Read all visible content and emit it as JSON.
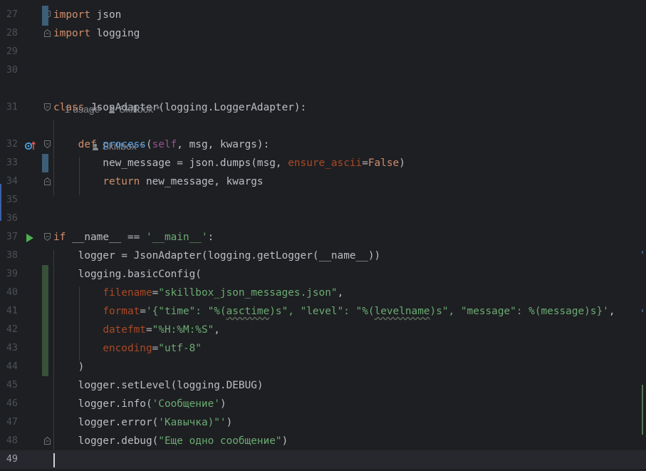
{
  "editor": {
    "lines": [
      {
        "num": "27",
        "tokens": [
          [
            "kw",
            "import"
          ],
          [
            "plain",
            " json"
          ]
        ]
      },
      {
        "num": "28",
        "tokens": [
          [
            "kw",
            "import"
          ],
          [
            "plain",
            " logging"
          ]
        ]
      },
      {
        "num": "29",
        "tokens": []
      },
      {
        "num": "30",
        "tokens": []
      },
      {
        "num": "31",
        "tokens": [
          [
            "kw",
            "class "
          ],
          [
            "plain",
            "JsonAdapter(logging.LoggerAdapter):"
          ]
        ]
      },
      {
        "num": "32",
        "tokens": [
          [
            "plain",
            "    "
          ],
          [
            "kw",
            "def "
          ],
          [
            "fn",
            "process"
          ],
          [
            "plain",
            "("
          ],
          [
            "self",
            "self"
          ],
          [
            "plain",
            ", msg, kwargs):"
          ]
        ]
      },
      {
        "num": "33",
        "tokens": [
          [
            "plain",
            "        new_message = json.dumps(msg, "
          ],
          [
            "param",
            "ensure_ascii"
          ],
          [
            "plain",
            "="
          ],
          [
            "kw",
            "False"
          ],
          [
            "plain",
            ")"
          ]
        ]
      },
      {
        "num": "34",
        "tokens": [
          [
            "plain",
            "        "
          ],
          [
            "kw",
            "return "
          ],
          [
            "plain",
            "new_message, kwargs"
          ]
        ]
      },
      {
        "num": "35",
        "tokens": []
      },
      {
        "num": "36",
        "tokens": []
      },
      {
        "num": "37",
        "tokens": [
          [
            "kw",
            "if "
          ],
          [
            "plain",
            "__name__ == "
          ],
          [
            "str",
            "'__main__'"
          ],
          [
            "plain",
            ":"
          ]
        ]
      },
      {
        "num": "38",
        "tokens": [
          [
            "plain",
            "    logger = JsonAdapter(logging.getLogger(__name__))"
          ]
        ]
      },
      {
        "num": "39",
        "tokens": [
          [
            "plain",
            "    logging.basicConfig("
          ]
        ]
      },
      {
        "num": "40",
        "tokens": [
          [
            "plain",
            "        "
          ],
          [
            "param",
            "filename"
          ],
          [
            "plain",
            "="
          ],
          [
            "str",
            "\"skillbox_json_messages.json\""
          ],
          [
            "plain",
            ","
          ]
        ]
      },
      {
        "num": "41",
        "tokens": [
          [
            "plain",
            "        "
          ],
          [
            "param",
            "format"
          ],
          [
            "plain",
            "="
          ],
          [
            "str",
            "'{\"time\": \"%("
          ],
          [
            "strw",
            "asctime"
          ],
          [
            "str",
            ")s\", \"level\": \"%("
          ],
          [
            "strw",
            "levelname"
          ],
          [
            "str",
            ")s\", \"message\": %(message)s}'"
          ],
          [
            "plain",
            ","
          ]
        ]
      },
      {
        "num": "42",
        "tokens": [
          [
            "plain",
            "        "
          ],
          [
            "param",
            "datefmt"
          ],
          [
            "plain",
            "="
          ],
          [
            "str",
            "\"%H:%M:%S\""
          ],
          [
            "plain",
            ","
          ]
        ]
      },
      {
        "num": "43",
        "tokens": [
          [
            "plain",
            "        "
          ],
          [
            "param",
            "encoding"
          ],
          [
            "plain",
            "="
          ],
          [
            "str",
            "\"utf-8\""
          ]
        ]
      },
      {
        "num": "44",
        "tokens": [
          [
            "plain",
            "    )"
          ]
        ]
      },
      {
        "num": "45",
        "tokens": [
          [
            "plain",
            "    logger.setLevel(logging.DEBUG)"
          ]
        ]
      },
      {
        "num": "46",
        "tokens": [
          [
            "plain",
            "    logger.info("
          ],
          [
            "str",
            "'Сообщение'"
          ],
          [
            "plain",
            ")"
          ]
        ]
      },
      {
        "num": "47",
        "tokens": [
          [
            "plain",
            "    logger.error("
          ],
          [
            "str",
            "'Кавычка)\"'"
          ],
          [
            "plain",
            ")"
          ]
        ]
      },
      {
        "num": "48",
        "tokens": [
          [
            "plain",
            "    logger.debug("
          ],
          [
            "str",
            "\"Еще одно сообщение\""
          ],
          [
            "plain",
            ")"
          ]
        ]
      },
      {
        "num": "49",
        "tokens": []
      }
    ],
    "hint_class": {
      "usages": "1 usage",
      "author": "Skillbox *"
    },
    "hint_method": {
      "author": "Skillbox *"
    },
    "colors": {
      "background": "#1e1f22",
      "keyword": "#cf8e6d",
      "function": "#56a8f5",
      "string": "#6aab73",
      "param": "#aa4926",
      "self": "#94558d"
    }
  }
}
